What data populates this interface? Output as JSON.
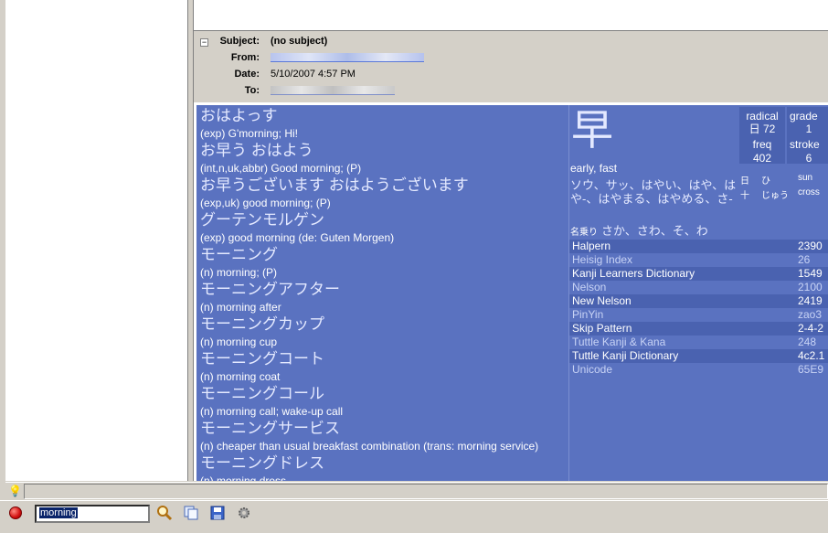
{
  "header": {
    "subject_label": "Subject:",
    "subject_value": "(no subject)",
    "from_label": "From:",
    "date_label": "Date:",
    "date_value": "5/10/2007 4:57 PM",
    "to_label": "To:",
    "collapse_symbol": "−"
  },
  "entries": [
    {
      "jp": "おはよっす",
      "en": "(exp) G'morning; Hi!"
    },
    {
      "jp": "お早う おはよう",
      "en": "(int,n,uk,abbr) Good morning; (P)"
    },
    {
      "jp": "お早うございます おはようございます",
      "en": "(exp,uk) good morning; (P)"
    },
    {
      "jp": "グーテンモルゲン",
      "en": "(exp) good morning (de: Guten Morgen)"
    },
    {
      "jp": "モーニング",
      "en": "(n) morning; (P)"
    },
    {
      "jp": "モーニングアフター",
      "en": "(n) morning after"
    },
    {
      "jp": "モーニングカップ",
      "en": "(n) morning cup"
    },
    {
      "jp": "モーニングコート",
      "en": "(n) morning coat"
    },
    {
      "jp": "モーニングコール",
      "en": "(n) morning call; wake-up call"
    },
    {
      "jp": "モーニングサービス",
      "en": "(n) cheaper than usual breakfast combination (trans: morning service)"
    },
    {
      "jp": "モーニングドレス",
      "en": "(n) morning dress"
    }
  ],
  "kanji": {
    "character": "早",
    "meaning": "early, fast",
    "readings": "ソウ、サッ、はやい、はや、はや-、はやまる、はやめる、さ-",
    "nanori_label": "名乗り",
    "nanori": "さか、さわ、そ、わ",
    "stats": {
      "radical_label": "radical",
      "radical_value": "日 72",
      "grade_label": "grade",
      "grade_value": "1",
      "freq_label": "freq",
      "freq_value": "402",
      "strokes_label": "stroke",
      "strokes_value": "6"
    },
    "parts": [
      {
        "kanji": "日",
        "reading": "ひ",
        "en": "sun"
      },
      {
        "kanji": "十",
        "reading": "じゅう",
        "en": "cross"
      }
    ]
  },
  "dictionary_refs": [
    {
      "name": "Halpern",
      "value": "2390"
    },
    {
      "name": "Heisig Index",
      "value": "26"
    },
    {
      "name": "Kanji Learners Dictionary",
      "value": "1549"
    },
    {
      "name": "Nelson",
      "value": "2100"
    },
    {
      "name": "New Nelson",
      "value": "2419"
    },
    {
      "name": "PinYin",
      "value": "zao3"
    },
    {
      "name": "Skip Pattern",
      "value": "2-4-2"
    },
    {
      "name": "Tuttle Kanji & Kana",
      "value": "248"
    },
    {
      "name": "Tuttle Kanji Dictionary",
      "value": "4c2.1"
    },
    {
      "name": "Unicode",
      "value": "65E9"
    }
  ],
  "toolbar": {
    "search_value": "morning",
    "search_icon": "magnifier-icon",
    "copy_icon": "copy-icon",
    "save_icon": "floppy-save-icon",
    "settings_icon": "gear-icon"
  }
}
